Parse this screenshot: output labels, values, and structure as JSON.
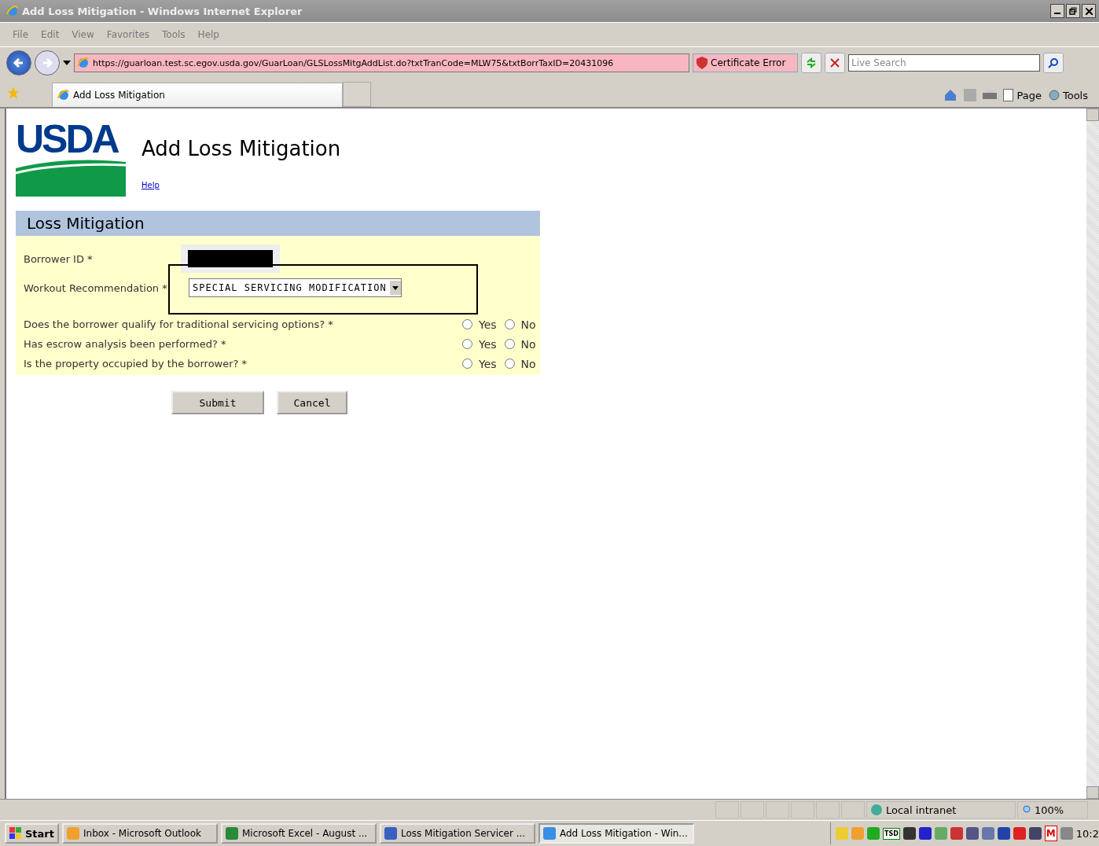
{
  "window": {
    "title": "Add Loss Mitigation - Windows Internet Explorer"
  },
  "menu": [
    "File",
    "Edit",
    "View",
    "Favorites",
    "Tools",
    "Help"
  ],
  "address": {
    "url": "https://guarloan.test.sc.egov.usda.gov/GuarLoan/GLSLossMitgAddList.do?txtTranCode=MLW75&txtBorrTaxID=20431096",
    "certificate": "Certificate Error",
    "search_placeholder": "Live Search"
  },
  "tab": {
    "label": "Add Loss Mitigation",
    "selected": true
  },
  "command_bar": {
    "page": "Page",
    "tools": "Tools"
  },
  "page": {
    "logo": "USDA",
    "title": "Add Loss Mitigation",
    "help": "Help",
    "section": "Loss Mitigation",
    "borrower_label": "Borrower ID *",
    "workout_label": "Workout Recommendation *",
    "workout_value": "SPECIAL SERVICING MODIFICATION",
    "questions": [
      {
        "text": "Does the borrower qualify for traditional servicing options? *",
        "options": [
          {
            "label": "Yes",
            "selected": false
          },
          {
            "label": "No",
            "selected": false
          }
        ]
      },
      {
        "text": "Has escrow analysis been performed? *",
        "options": [
          {
            "label": "Yes",
            "selected": false
          },
          {
            "label": "No",
            "selected": false
          }
        ]
      },
      {
        "text": "Is the property occupied by the borrower? *",
        "options": [
          {
            "label": "Yes",
            "selected": false
          },
          {
            "label": "No",
            "selected": false
          }
        ]
      }
    ],
    "buttons": [
      "Submit",
      "Cancel"
    ]
  },
  "status_bar": {
    "zone": "Local intranet",
    "zoom": "100%"
  },
  "taskbar": {
    "start": "Start",
    "items": [
      {
        "label": "Inbox - Microsoft Outlook",
        "selected": false
      },
      {
        "label": "Microsoft Excel - August ...",
        "selected": false
      },
      {
        "label": "Loss Mitigation Servicer ...",
        "selected": false
      },
      {
        "label": "Add Loss Mitigation - Win...",
        "selected": true
      }
    ],
    "tray_labels": [
      "TSD",
      "M"
    ],
    "clock": "10:2"
  }
}
